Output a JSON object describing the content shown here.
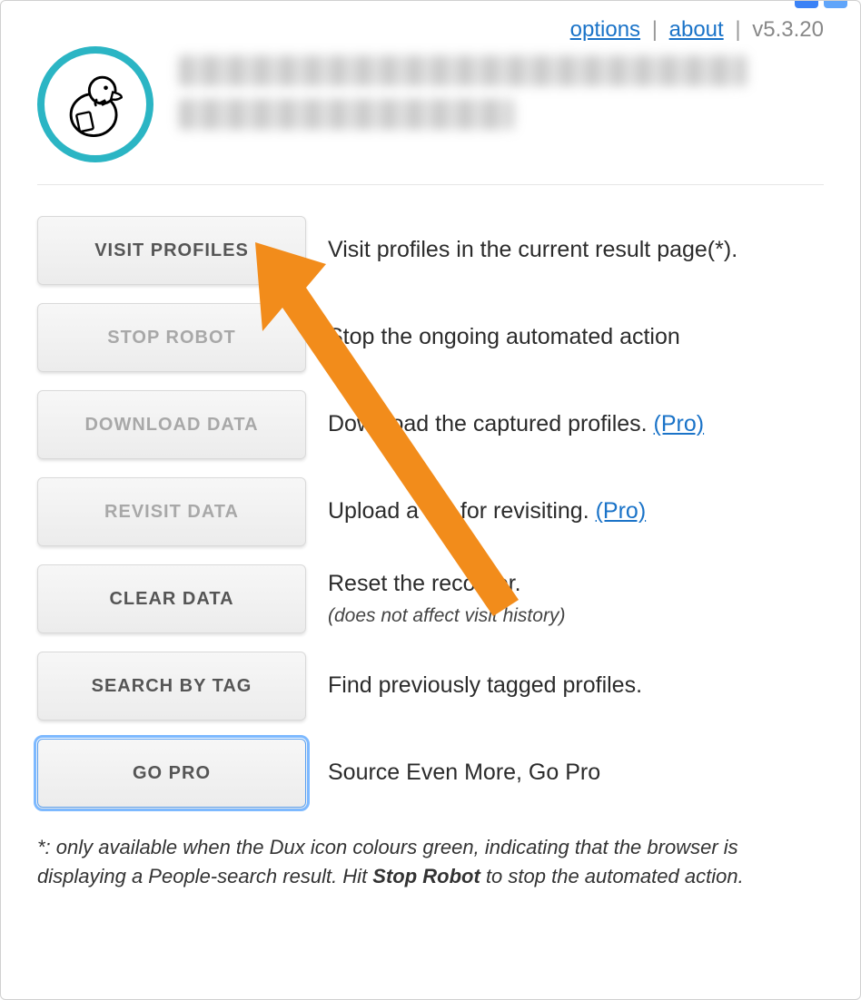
{
  "topnav": {
    "options": "options",
    "about": "about",
    "version": "v5.3.20"
  },
  "buttons": {
    "visit_profiles": "VISIT PROFILES",
    "stop_robot": "STOP ROBOT",
    "download_data": "DOWNLOAD DATA",
    "revisit_data": "REVISIT DATA",
    "clear_data": "CLEAR DATA",
    "search_by_tag": "SEARCH BY TAG",
    "go_pro": "GO PRO"
  },
  "descriptions": {
    "visit_profiles": "Visit profiles in the current result page(*).",
    "stop_robot": "Stop the ongoing automated action",
    "download_data_pre": "Download the captured profiles. ",
    "download_data_link": "(Pro)",
    "revisit_data_pre": "Upload a file for revisiting. ",
    "revisit_data_link": "(Pro)",
    "clear_data": "Reset the recorder.",
    "clear_data_sub": "(does not affect visit history)",
    "search_by_tag": "Find previously tagged profiles.",
    "go_pro": "Source Even More, Go Pro"
  },
  "footnote": {
    "pre": "*: only available when the Dux icon colours green, indicating that the browser is displaying a People-search result. Hit ",
    "bold": "Stop Robot",
    "post": " to stop the automated action."
  }
}
